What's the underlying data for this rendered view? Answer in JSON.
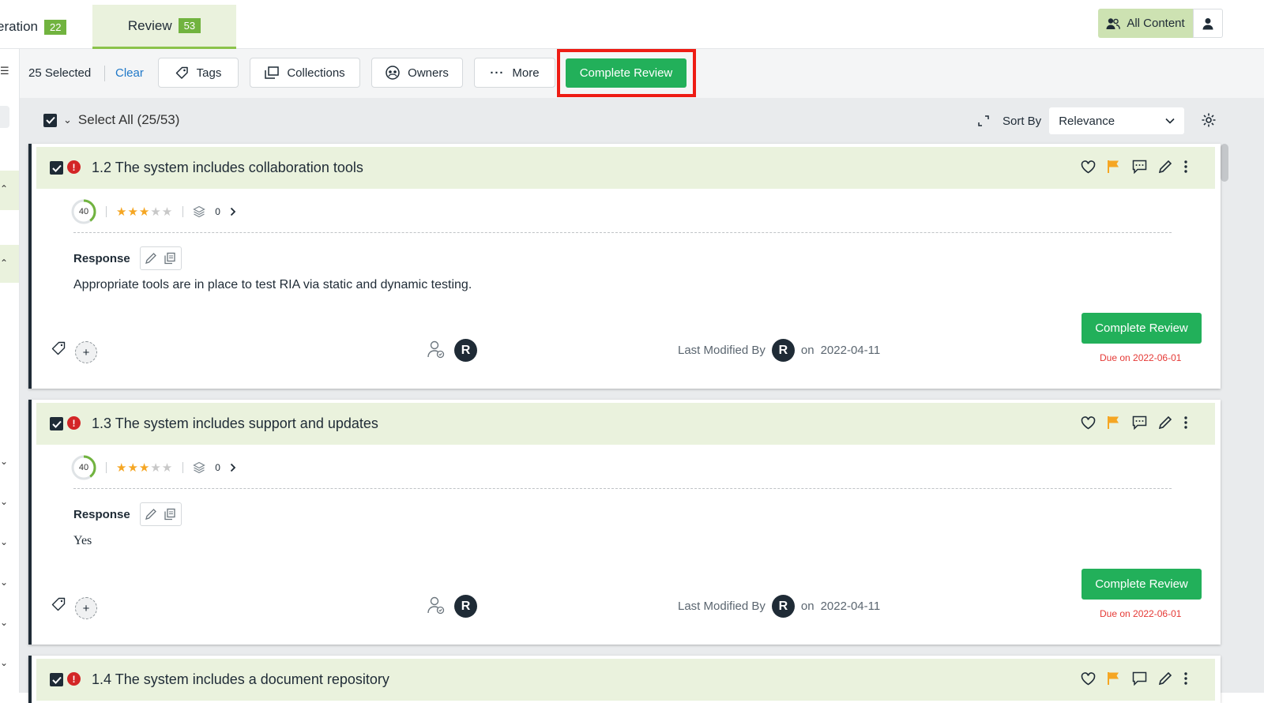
{
  "tabs": [
    {
      "label": "eration",
      "count": "22"
    },
    {
      "label": "Review",
      "count": "53"
    }
  ],
  "header": {
    "all_content_label": "All Content"
  },
  "toolbar": {
    "selected_count": "25",
    "selected_label": "Selected",
    "clear_label": "Clear",
    "tags_label": "Tags",
    "collections_label": "Collections",
    "owners_label": "Owners",
    "more_label": "More",
    "complete_review_label": "Complete Review"
  },
  "list": {
    "select_all_label": "Select All (25/53)",
    "sort_by_label": "Sort By",
    "sort_value": "Relevance"
  },
  "cards": [
    {
      "title": "1.2 The system includes collaboration tools",
      "score": "40",
      "rating": 3,
      "collections_count": "0",
      "response_label": "Response",
      "answer": "Appropriate tools are in place to test RIA via static and dynamic testing.",
      "last_modified_label": "Last Modified By",
      "on_label": "on",
      "date": "2022-04-11",
      "button_label": "Complete Review",
      "due": "Due on 2022-06-01"
    },
    {
      "title": "1.3 The system includes support and updates",
      "score": "40",
      "rating": 3,
      "collections_count": "0",
      "response_label": "Response",
      "answer": "Yes",
      "last_modified_label": "Last Modified By",
      "on_label": "on",
      "date": "2022-04-11",
      "button_label": "Complete Review",
      "due": "Due on 2022-06-01"
    },
    {
      "title": "1.4 The system includes a document repository"
    }
  ],
  "colors": {
    "accent_green": "#22b05a",
    "tab_count_green": "#71b33f",
    "highlight_red": "#ee1c14",
    "flag_orange": "#f5a623",
    "due_red": "#e53935"
  }
}
